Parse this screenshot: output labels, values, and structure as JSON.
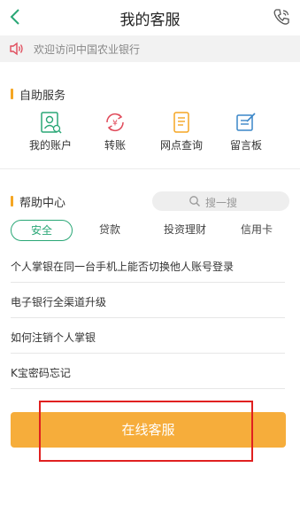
{
  "header": {
    "title": "我的客服"
  },
  "notice": {
    "text": "欢迎访问中国农业银行"
  },
  "self_service": {
    "title": "自助服务",
    "items": [
      {
        "label": "我的账户",
        "icon": "account-icon"
      },
      {
        "label": "转账",
        "icon": "transfer-icon"
      },
      {
        "label": "网点查询",
        "icon": "branch-query-icon"
      },
      {
        "label": "留言板",
        "icon": "message-board-icon"
      }
    ]
  },
  "help_center": {
    "title": "帮助中心",
    "search_placeholder": "搜一搜",
    "tabs": [
      {
        "label": "安全",
        "active": true
      },
      {
        "label": "贷款",
        "active": false
      },
      {
        "label": "投资理财",
        "active": false
      },
      {
        "label": "信用卡",
        "active": false
      }
    ],
    "faqs": [
      "个人掌银在同一台手机上能否切换他人账号登录",
      "电子银行全渠道升级",
      "如何注销个人掌银",
      "K宝密码忘记"
    ]
  },
  "online_service": {
    "label": "在线客服"
  },
  "colors": {
    "accent_green": "#2aa776",
    "button_orange": "#f6ad3b",
    "section_mark": "#f5a623",
    "highlight_red": "#e02020"
  }
}
